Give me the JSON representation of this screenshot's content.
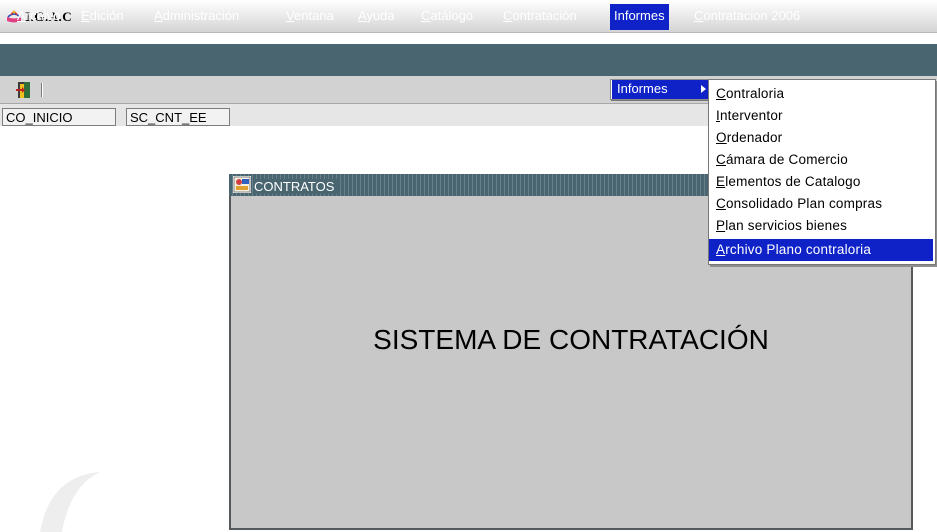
{
  "window": {
    "title": "I.G.A.C"
  },
  "menubar": {
    "items": [
      {
        "mnemonic": "A",
        "rest": "rchivo"
      },
      {
        "mnemonic": "E",
        "rest": "dición"
      },
      {
        "mnemonic": "A",
        "rest": "dministración"
      },
      {
        "mnemonic": "V",
        "rest": "entana"
      },
      {
        "mnemonic": "A",
        "rest": "yuda"
      },
      {
        "mnemonic": "C",
        "rest": "atálogo"
      },
      {
        "mnemonic": "C",
        "rest": "ontratación"
      },
      {
        "mnemonic": "",
        "rest": "Informes"
      },
      {
        "mnemonic": "C",
        "rest": "ontratacion 2006"
      }
    ]
  },
  "toolbar": {
    "exit_icon": "exit-door-icon"
  },
  "status": {
    "fields": [
      "CO_INICIO",
      "SC_CNT_EE"
    ]
  },
  "form": {
    "title": "CONTRATOS",
    "banner": "SISTEMA DE CONTRATACIÓN",
    "icon": "form-app-icon"
  },
  "submenu": {
    "label": "Informes"
  },
  "dropdown": {
    "items": [
      {
        "mnemonic": "C",
        "rest": "ontraloria"
      },
      {
        "mnemonic": "I",
        "rest": "nterventor"
      },
      {
        "mnemonic": "O",
        "rest": "rdenador"
      },
      {
        "mnemonic": "C",
        "rest": "ámara de Comercio"
      },
      {
        "mnemonic": "E",
        "rest": "lementos de Catalogo"
      },
      {
        "mnemonic": "C",
        "rest": "onsolidado Plan compras"
      },
      {
        "mnemonic": "P",
        "rest": "lan servicios bienes"
      },
      {
        "mnemonic": "A",
        "rest": "rchivo Plano contraloria"
      }
    ],
    "highlighted_index": 7
  },
  "colors": {
    "menubar": "#486570",
    "highlight": "#0e22c8",
    "form_body": "#c8c8c8"
  }
}
